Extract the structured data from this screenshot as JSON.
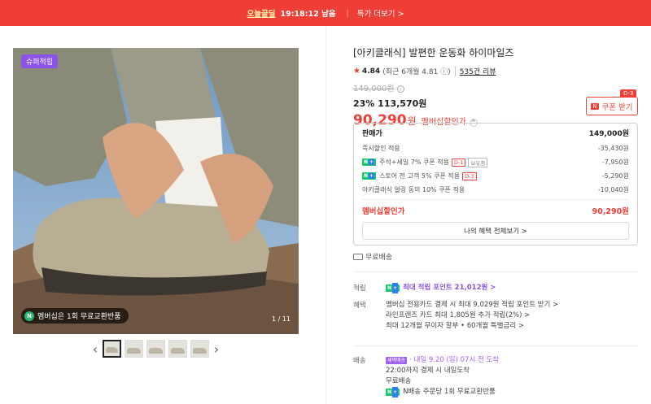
{
  "topbar": {
    "brand": "오늘끝딜",
    "timer": "19:18:12 남음",
    "more": "특가 더보기 >"
  },
  "gallery": {
    "badge": "슈퍼적립",
    "member_tag": "멤버십은 1회 무료교환반품",
    "member_icon": "N",
    "pager": "1 / 11",
    "prev": "‹",
    "next": "›",
    "thumb_count": 5
  },
  "product": {
    "title": "[아키클래식] 발편한 운동화 하이마일즈",
    "rating": "4.84",
    "rating_recent": "(최근 6개월 4.81",
    "reviews": "535건 리뷰",
    "original_price": "149,000원",
    "sale": "23% 113,570원",
    "member_price": "90,290",
    "member_won": "원",
    "member_label": "멤버십할인가",
    "coupon_label": "쿠폰 받기",
    "coupon_dday": "D-3"
  },
  "breakdown": {
    "rows": [
      {
        "label": "즉시할인 적용",
        "value": "-35,430원"
      },
      {
        "label": "주석+세일 7% 쿠폰 적용",
        "value": "-7,950원",
        "tag": "D-1",
        "tag2": "보유중",
        "np": true
      },
      {
        "label": "스토어 전 고객 5% 쿠폰 적용",
        "value": "-5,290원",
        "tag": "D-3",
        "np": true
      },
      {
        "label": "아키클래식 얼링 동의 10% 쿠폰 적용",
        "value": "-10,040원"
      }
    ],
    "head_label": "판매가",
    "head_value": "149,000원",
    "final_label": "멤버십할인가",
    "final_value": "90,290원",
    "all_button": "나의 혜택 전체보기 >"
  },
  "shipping": {
    "free": "무료배송"
  },
  "benefits": {
    "points_key": "적립",
    "points_value": "최대 적립 포인트 21,012원 >",
    "perks_key": "혜택",
    "perks": [
      "멤버십 전용카드 결제 시 최대 9,029원 적립 포인트 받기 >",
      "라인프렌즈 카드 최대 1,805원 추가 적립(2%) >",
      "최대 12개월 무이자 할부 • 60개월 특별금리 >"
    ],
    "ship_key": "배송",
    "ship_badge": "새벽배송",
    "ship_lines": [
      "22:00까지 결제 시 내일도착",
      "무료배송"
    ],
    "ship_date": "· 내일 9.20 (일) 07시 전 도착",
    "ship_extra": "N배송 주문당 1회 무료교환반품"
  }
}
